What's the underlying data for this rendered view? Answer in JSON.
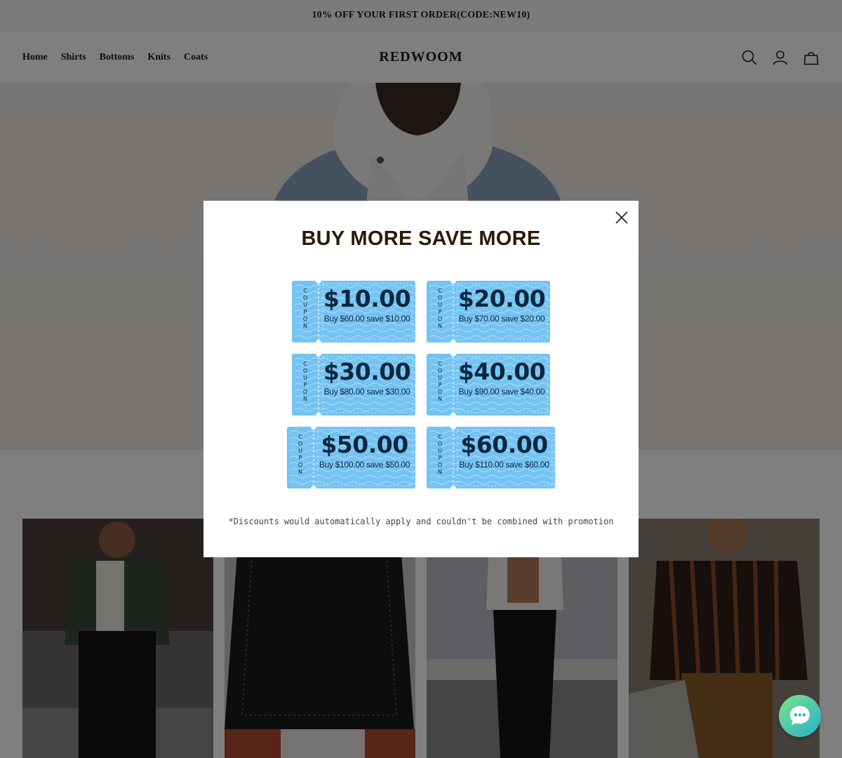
{
  "announcement": {
    "text": "10% OFF YOUR FIRST ORDER(CODE:NEW10)"
  },
  "header": {
    "nav": [
      "Home",
      "Shirts",
      "Bottoms",
      "Knits",
      "Coats"
    ],
    "logo": "REDWOOM",
    "icons": [
      "search-icon",
      "account-icon",
      "cart-icon"
    ]
  },
  "modal": {
    "title": "BUY MORE SAVE MORE",
    "stub_label": "COUPON",
    "coupons": [
      {
        "amount": "$10.00",
        "desc": "Buy $60.00 save $10.00"
      },
      {
        "amount": "$20.00",
        "desc": "Buy $70.00 save $20.00"
      },
      {
        "amount": "$30.00",
        "desc": "Buy $80.00 save $30.00"
      },
      {
        "amount": "$40.00",
        "desc": "Buy $90.00 save $40.00"
      },
      {
        "amount": "$50.00",
        "desc": "Buy $100.00 save $50.00"
      },
      {
        "amount": "$60.00",
        "desc": "Buy $110.00 save $60.00"
      }
    ],
    "note": "*Discounts would automatically apply and couldn't be combined with promotion"
  },
  "colors": {
    "coupon_blue": "#74c3f2",
    "coupon_text": "#0c2740",
    "title": "#2a1a05",
    "overlay": "rgba(0,0,0,0.5)",
    "chat_gradient": [
      "#7ee08a",
      "#24b4c9"
    ]
  }
}
